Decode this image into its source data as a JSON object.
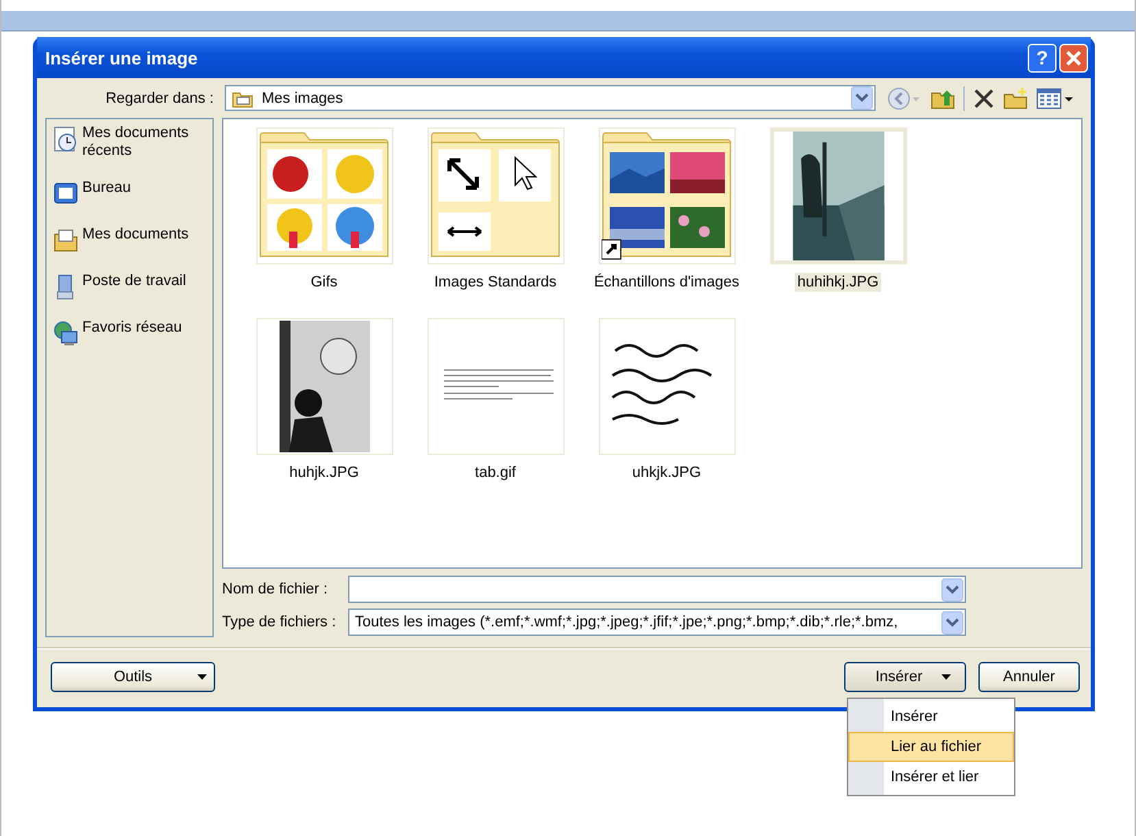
{
  "window": {
    "title": "Insérer une image",
    "help": "?"
  },
  "look_in": {
    "label": "Regarder dans :",
    "value": "Mes images"
  },
  "sidebar": {
    "items": [
      {
        "label": "Mes documents récents",
        "kind": "recent",
        "selected": false
      },
      {
        "label": "Bureau",
        "kind": "desktop",
        "selected": false
      },
      {
        "label": "Mes documents",
        "kind": "documents",
        "selected": false
      },
      {
        "label": "Poste de travail",
        "kind": "computer",
        "selected": false
      },
      {
        "label": "Favoris réseau",
        "kind": "network",
        "selected": false
      }
    ]
  },
  "files": [
    {
      "name": "Gifs",
      "kind": "folder-emoji",
      "selected": false
    },
    {
      "name": "Images Standards",
      "kind": "folder-cursors",
      "selected": false
    },
    {
      "name": "Échantillons d'images",
      "kind": "folder-photos",
      "selected": false
    },
    {
      "name": "huhihkj.JPG",
      "selected": true
    },
    {
      "name": "huhjk.JPG",
      "kind": "photo-bw",
      "selected": false
    },
    {
      "name": "tab.gif",
      "kind": "document",
      "selected": false
    },
    {
      "name": "uhkjk.JPG",
      "kind": "handwriting",
      "selected": false
    }
  ],
  "file_name": {
    "label": "Nom de fichier :"
  },
  "file_type": {
    "label": "Type de fichiers :",
    "value": "Toutes les images (*.emf;*.wmf;*.jpg;*.jpeg;*.jfif;*.jpe;*.png;*.bmp;*.dib;*.rle;*.bmz,"
  },
  "buttons": {
    "tools": "Outils",
    "insert": "Insérer",
    "cancel": "Annuler"
  },
  "insert_menu": [
    {
      "label": "Insérer",
      "selected": false
    },
    {
      "label": "Lier au fichier",
      "selected": true
    },
    {
      "label": "Insérer et lier",
      "selected": false
    }
  ]
}
